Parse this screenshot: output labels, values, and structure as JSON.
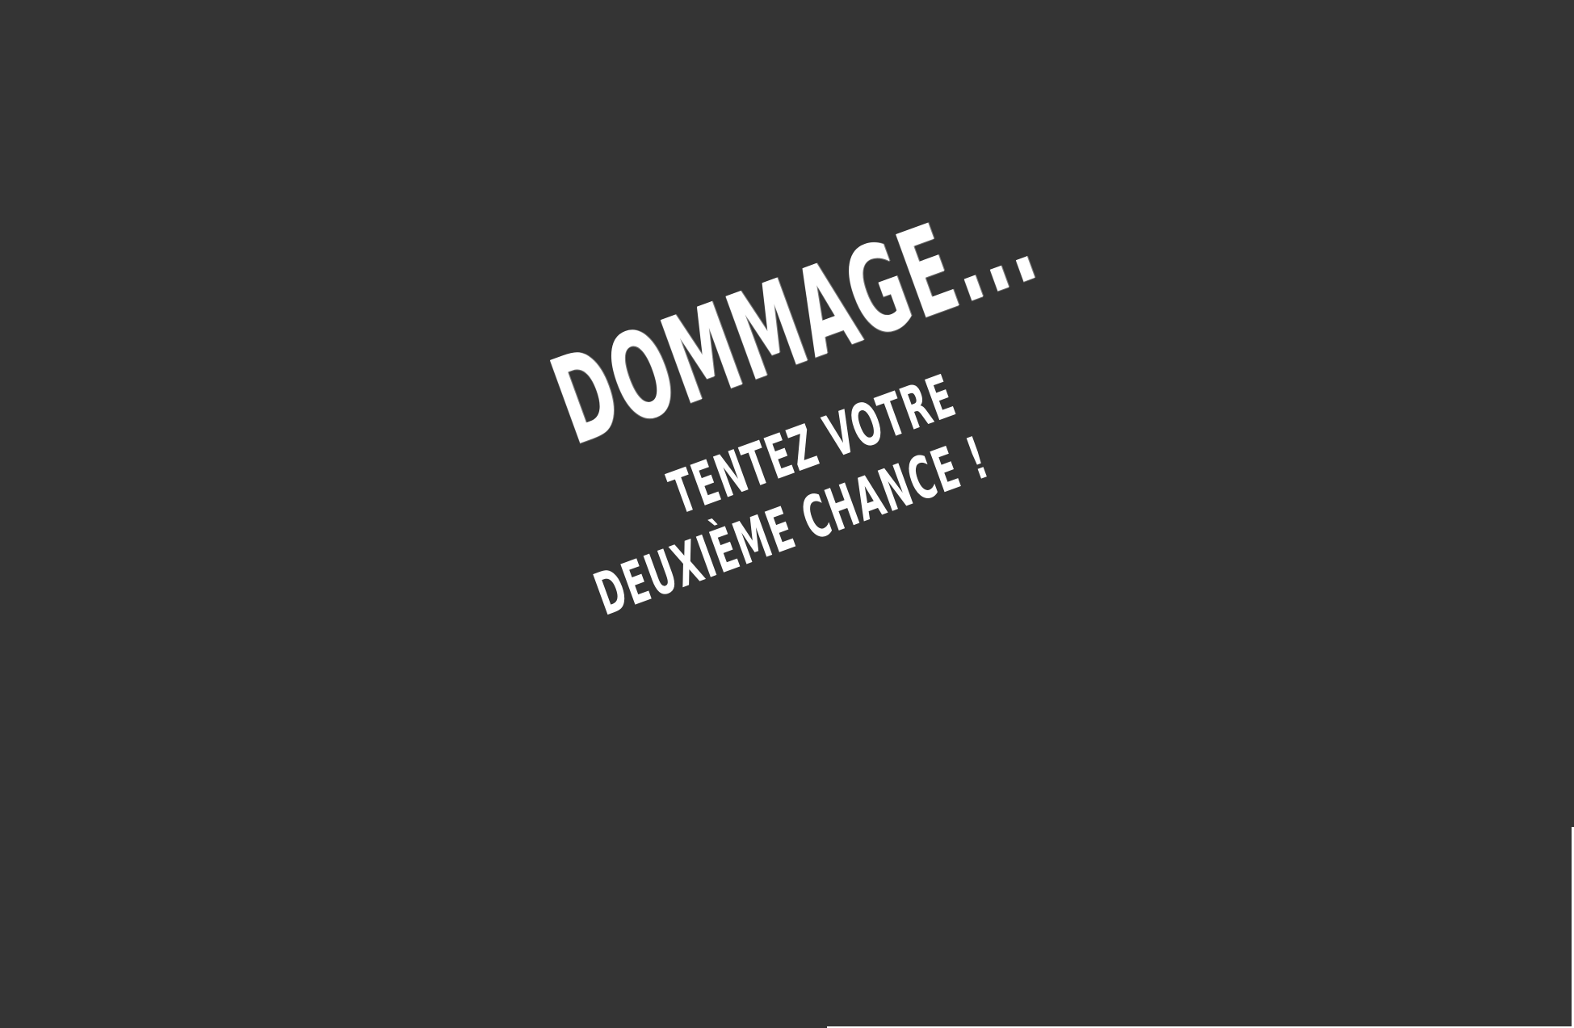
{
  "message": {
    "headline": "DOMMAGE...",
    "line1": "TENTEZ VOTRE",
    "line2": "DEUXIÈME CHANCE !"
  },
  "colors": {
    "background": "#343434",
    "text": "#ffffff"
  }
}
